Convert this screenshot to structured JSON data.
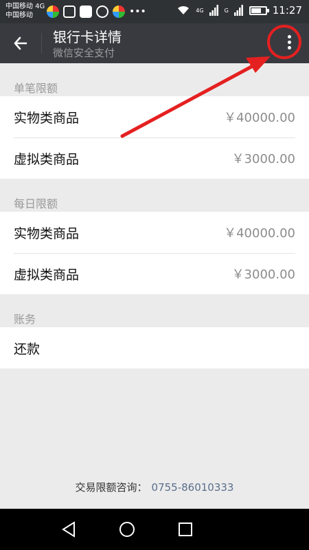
{
  "status_bar": {
    "carrier_line1": "中国移动 4G",
    "carrier_line2": "中国移动",
    "time": "11:27",
    "network_4g": "4G",
    "network_g": "G"
  },
  "header": {
    "title": "银行卡详情",
    "subtitle": "微信安全支付"
  },
  "sections": [
    {
      "label": "单笔限额",
      "rows": [
        {
          "name": "实物类商品",
          "value": "￥40000.00"
        },
        {
          "name": "虚拟类商品",
          "value": "￥3000.00"
        }
      ]
    },
    {
      "label": "每日限额",
      "rows": [
        {
          "name": "实物类商品",
          "value": "￥40000.00"
        },
        {
          "name": "虚拟类商品",
          "value": "￥3000.00"
        }
      ]
    },
    {
      "label": "账务",
      "rows": [
        {
          "name": "还款"
        }
      ]
    }
  ],
  "footer": {
    "label": "交易限额咨询：",
    "phone": "0755-86010333"
  },
  "colors": {
    "header_bg": "#393a3f",
    "annotation_red": "#e52020",
    "page_bg": "#ebebeb"
  }
}
